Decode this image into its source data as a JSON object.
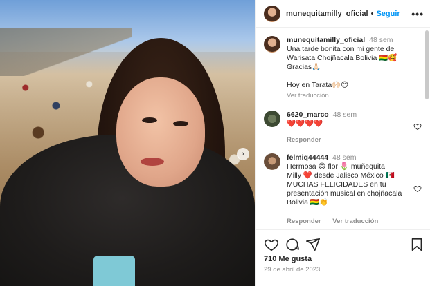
{
  "header": {
    "username": "munequitamilly_oficial",
    "separator": "•",
    "follow_label": "Seguir",
    "more_label": "•••"
  },
  "caption": {
    "username": "munequitamilly_oficial",
    "time": "48 sem",
    "text_line1": "Una tarde bonita con mi gente de",
    "text_line2": "Warisata Chojñacala Bolivia 🇧🇴🥰",
    "text_line3": "Gracias🙏🏻",
    "text_line4": "Hoy en Tarata🙌🏻😊",
    "translate_label": "Ver traducción"
  },
  "comments": [
    {
      "username": "6620_marco",
      "time": "48 sem",
      "text": "❤️❤️❤️❤️",
      "reply_label": "Responder",
      "translate_label": ""
    },
    {
      "username": "felmiq44444",
      "time": "48 sem",
      "text_line1": "Hermosa 😍 flor 🌷 muñequita",
      "text_line2": "Milly ❤️ desde Jalisco México 🇲🇽",
      "text_line3": "MUCHAS FELICIDADES en tu",
      "text_line4": "presentación musical en chojñacala",
      "text_line5": "Bolivia 🇧🇴👏",
      "reply_label": "Responder",
      "translate_label": "Ver traducción"
    }
  ],
  "actions": {
    "likes": "710 Me gusta",
    "date": "29 de abril de 2023"
  },
  "icons": {
    "like": "heart-icon",
    "comment": "comment-icon",
    "share": "share-icon",
    "save": "bookmark-icon",
    "next": "chevron-right-icon"
  },
  "colors": {
    "accent": "#0095f6",
    "heart": "#ed4956",
    "muted": "#8e8e8e"
  }
}
